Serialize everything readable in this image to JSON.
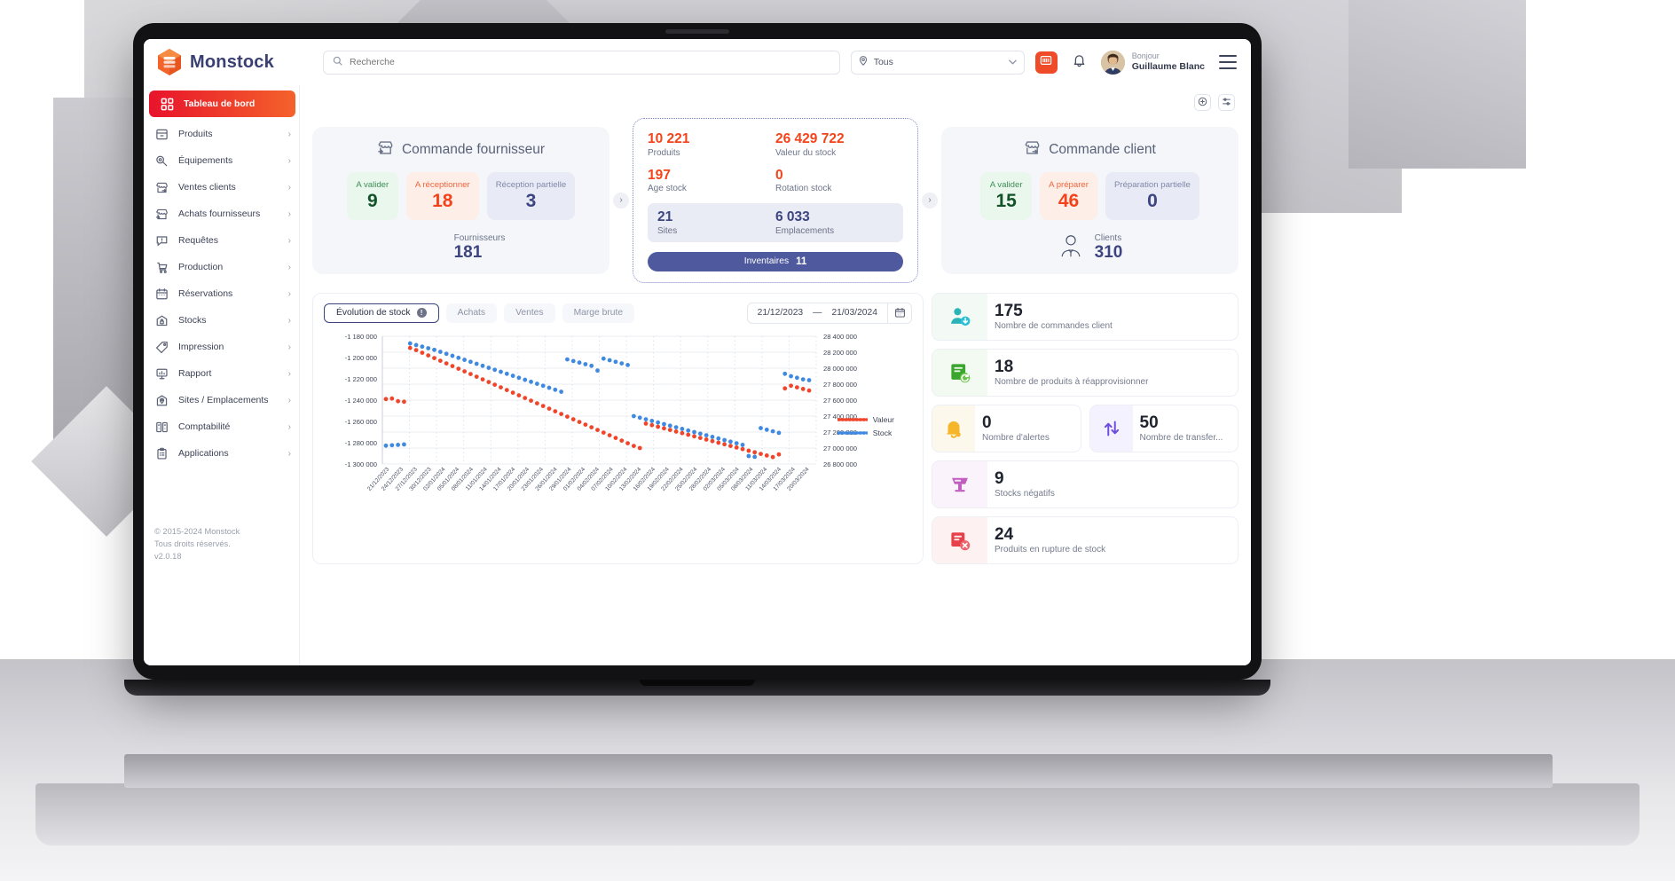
{
  "brand": {
    "name": "Monstock",
    "logo_icon": "monstock-cube-logo"
  },
  "topbar": {
    "search_placeholder": "Recherche",
    "search_value": "",
    "search_icon": "search-icon",
    "scope_select": {
      "value": "Tous",
      "icon": "location-pin-icon",
      "chevron": "chevron-down-icon"
    },
    "scan_icon": "barcode-scan-icon",
    "bell_icon": "notification-bell-icon",
    "menu_icon": "hamburger-menu-icon",
    "greeting": "Bonjour",
    "user_name": "Guillaume Blanc"
  },
  "sidebar": {
    "collapse_icon": "arrow-left-collapse-icon",
    "items": [
      {
        "label": "Tableau de bord",
        "icon": "dashboard-grid-icon",
        "active": true,
        "chevron": false
      },
      {
        "label": "Produits",
        "icon": "box-icon",
        "active": false,
        "chevron": true
      },
      {
        "label": "Équipements",
        "icon": "wrench-icon",
        "active": false,
        "chevron": true
      },
      {
        "label": "Ventes clients",
        "icon": "store-out-icon",
        "active": false,
        "chevron": true
      },
      {
        "label": "Achats fournisseurs",
        "icon": "store-in-icon",
        "active": false,
        "chevron": true
      },
      {
        "label": "Requêtes",
        "icon": "alert-chat-icon",
        "active": false,
        "chevron": true
      },
      {
        "label": "Production",
        "icon": "cart-production-icon",
        "active": false,
        "chevron": true
      },
      {
        "label": "Réservations",
        "icon": "calendar-icon",
        "active": false,
        "chevron": true
      },
      {
        "label": "Stocks",
        "icon": "warehouse-lock-icon",
        "active": false,
        "chevron": true
      },
      {
        "label": "Impression",
        "icon": "tag-print-icon",
        "active": false,
        "chevron": true
      },
      {
        "label": "Rapport",
        "icon": "chart-board-icon",
        "active": false,
        "chevron": true
      },
      {
        "label": "Sites / Emplacements",
        "icon": "location-house-icon",
        "active": false,
        "chevron": true
      },
      {
        "label": "Comptabilité",
        "icon": "ledger-book-icon",
        "active": false,
        "chevron": true
      },
      {
        "label": "Applications",
        "icon": "clipboard-apps-icon",
        "active": false,
        "chevron": true
      }
    ],
    "footer": {
      "copyright": "© 2015-2024 Monstock",
      "rights": "Tous droits réservés.",
      "version": "v2.0.18"
    }
  },
  "toolbar": {
    "add_icon": "plus-circle-icon",
    "settings_icon": "sliders-settings-icon"
  },
  "supplier_panel": {
    "title": "Commande fournisseur",
    "title_icon": "store-in-icon",
    "tiles": [
      {
        "label": "A valider",
        "value": "9",
        "tone": "green"
      },
      {
        "label": "A réceptionner",
        "value": "18",
        "tone": "orange"
      },
      {
        "label": "Réception partielle",
        "value": "3",
        "tone": "blue"
      }
    ],
    "footer": {
      "icon": "supplier-person-icon",
      "label": "Fournisseurs",
      "value": "181"
    }
  },
  "stock_card": {
    "metrics": [
      {
        "label": "Produits",
        "value": "10 221"
      },
      {
        "label": "Valeur du stock",
        "value": "26 429 722"
      },
      {
        "label": "Age stock",
        "value": "197"
      },
      {
        "label": "Rotation stock",
        "value": "0"
      }
    ],
    "strip": [
      {
        "label": "Sites",
        "value": "21"
      },
      {
        "label": "Emplacements",
        "value": "6 033"
      }
    ],
    "button": {
      "label": "Inventaires",
      "count": "11"
    }
  },
  "client_panel": {
    "title": "Commande client",
    "title_icon": "store-out-icon",
    "tiles": [
      {
        "label": "A valider",
        "value": "15",
        "tone": "green"
      },
      {
        "label": "A préparer",
        "value": "46",
        "tone": "orange"
      },
      {
        "label": "Préparation partielle",
        "value": "0",
        "tone": "blue"
      }
    ],
    "footer": {
      "icon": "client-person-icon",
      "label": "Clients",
      "value": "310"
    }
  },
  "chart_panel": {
    "tabs": [
      {
        "label": "Évolution de stock",
        "active": true,
        "info_icon": "info-icon"
      },
      {
        "label": "Achats",
        "active": false
      },
      {
        "label": "Ventes",
        "active": false
      },
      {
        "label": "Marge brute",
        "active": false
      }
    ],
    "date_from": "21/12/2023",
    "date_sep": "—",
    "date_to": "21/03/2024",
    "calendar_icon": "calendar-icon"
  },
  "chart_data": {
    "type": "scatter",
    "title": "Évolution de stock",
    "xlabel": "",
    "grid": true,
    "legend_position": "right",
    "y_left": {
      "label": "Valeur",
      "ticks": [
        "-1 180 000",
        "-1 200 000",
        "-1 220 000",
        "-1 240 000",
        "-1 260 000",
        "-1 280 000",
        "-1 300 000"
      ],
      "min": -1300000,
      "max": -1180000
    },
    "y_right": {
      "label": "Stock",
      "ticks": [
        "28 400 000",
        "28 200 000",
        "28 000 000",
        "27 800 000",
        "27 600 000",
        "27 400 000",
        "27 200 000",
        "27 000 000",
        "26 800 000"
      ],
      "min": 26800000,
      "max": 28400000
    },
    "x_ticks": [
      "21/12/2023",
      "24/12/2023",
      "27/12/2023",
      "30/12/2023",
      "02/01/2024",
      "05/01/2024",
      "08/01/2024",
      "11/01/2024",
      "14/01/2024",
      "17/01/2024",
      "20/01/2024",
      "23/01/2024",
      "26/01/2024",
      "29/01/2024",
      "01/02/2024",
      "04/02/2024",
      "07/02/2024",
      "10/02/2024",
      "13/02/2024",
      "16/02/2024",
      "19/02/2024",
      "22/02/2024",
      "25/02/2024",
      "28/02/2024",
      "02/03/2024",
      "05/03/2024",
      "08/03/2024",
      "11/03/2024",
      "14/03/2024",
      "17/03/2024",
      "20/03/2024"
    ],
    "series": [
      {
        "name": "Valeur",
        "color": "#f0452a",
        "style": "dotted",
        "values": [
          -1239000,
          -1238500,
          -1241000,
          -1241500,
          -1191000,
          -1193000,
          -1195500,
          -1198000,
          -1200500,
          -1203000,
          -1205500,
          -1208000,
          -1210500,
          -1213000,
          -1215500,
          -1218000,
          -1220500,
          -1223000,
          -1225500,
          -1228000,
          -1230500,
          -1233000,
          -1235500,
          -1238000,
          -1240500,
          -1243000,
          -1245500,
          -1248000,
          -1250500,
          -1253000,
          -1255500,
          -1258000,
          -1260500,
          -1263000,
          -1265500,
          -1268000,
          -1270500,
          -1273000,
          -1275500,
          -1278000,
          -1280500,
          -1283000,
          -1285000,
          -1262000,
          -1263500,
          -1265000,
          -1266500,
          -1268000,
          -1269500,
          -1271000,
          -1272500,
          -1274000,
          -1275500,
          -1277000,
          -1278500,
          -1280000,
          -1281500,
          -1283000,
          -1284500,
          -1286000,
          -1287500,
          -1289000,
          -1290500,
          -1292000,
          -1293500,
          -1291000,
          -1229000,
          -1226500,
          -1228000,
          -1229500,
          -1231000
        ]
      },
      {
        "name": "Stock",
        "color": "#3f8ae0",
        "style": "dotted",
        "values": [
          27030000,
          27035000,
          27040000,
          27045000,
          28310000,
          28290000,
          28270000,
          28250000,
          28230000,
          28205000,
          28180000,
          28155000,
          28130000,
          28105000,
          28080000,
          28055000,
          28030000,
          28005000,
          27980000,
          27955000,
          27930000,
          27905000,
          27880000,
          27855000,
          27830000,
          27805000,
          27780000,
          27755000,
          27730000,
          27705000,
          28110000,
          28090000,
          28070000,
          28050000,
          28030000,
          27970000,
          28120000,
          28100000,
          28080000,
          28060000,
          28040000,
          27400000,
          27380000,
          27360000,
          27340000,
          27320000,
          27300000,
          27280000,
          27260000,
          27240000,
          27220000,
          27200000,
          27180000,
          27160000,
          27140000,
          27120000,
          27100000,
          27080000,
          27060000,
          27040000,
          26900000,
          26890000,
          27250000,
          27230000,
          27210000,
          27190000,
          27930000,
          27900000,
          27880000,
          27860000,
          27850000
        ]
      }
    ],
    "legend": [
      {
        "name": "Valeur",
        "color": "#f0452a"
      },
      {
        "name": "Stock",
        "color": "#3f8ae0"
      }
    ]
  },
  "kpis": [
    {
      "value": "175",
      "label": "Nombre de commandes client",
      "icon": "client-download-icon",
      "tone": "teal"
    },
    {
      "value": "18",
      "label": "Nombre de produits à réapprovisionner",
      "icon": "document-refresh-icon",
      "tone": "green"
    },
    {
      "value": "0",
      "label": "Nombre d'alertes",
      "icon": "bell-alert-icon",
      "tone": "amber"
    },
    {
      "value": "50",
      "label": "Nombre de transfer...",
      "icon": "transfer-arrows-icon",
      "tone": "violet"
    },
    {
      "value": "9",
      "label": "Stocks négatifs",
      "icon": "negative-stock-icon",
      "tone": "purple"
    },
    {
      "value": "24",
      "label": "Produits en rupture de stock",
      "icon": "out-of-stock-icon",
      "tone": "red"
    }
  ],
  "colors": {
    "brand_red": "#e8132b",
    "brand_orange": "#f4622b",
    "navy": "#3c4580",
    "series_valeur": "#f0452a",
    "series_stock": "#3f8ae0"
  }
}
